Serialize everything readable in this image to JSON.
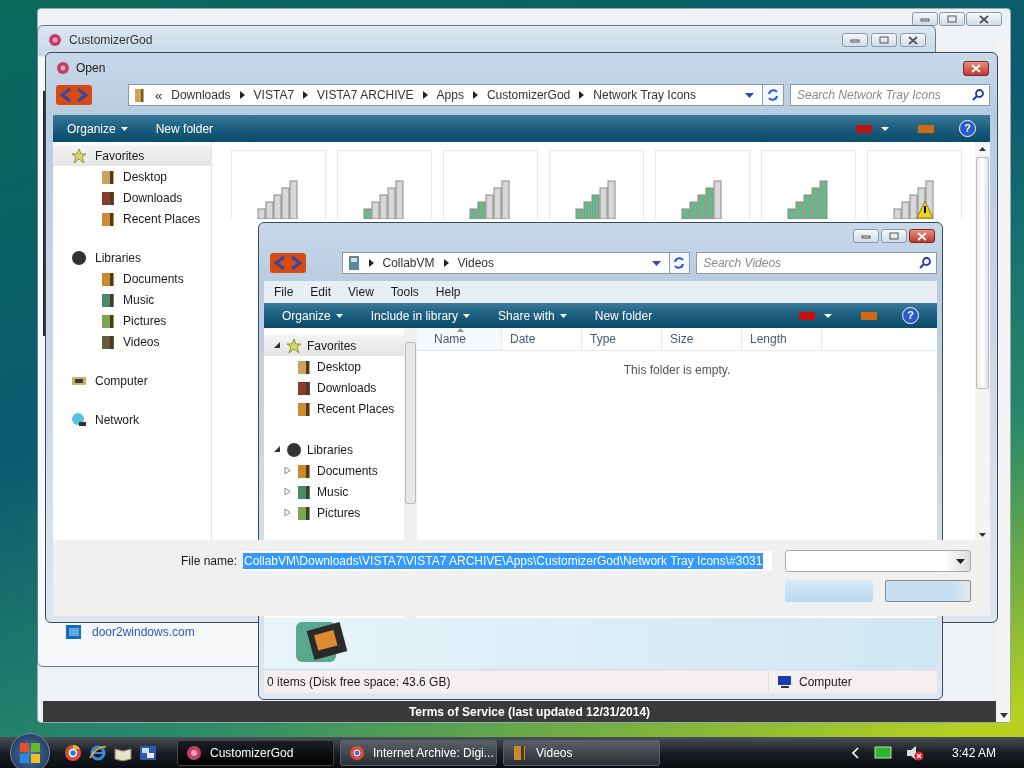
{
  "browser_window": {
    "footer": "Terms of Service (last updated 12/31/2014)"
  },
  "app_window": {
    "title": "CustomizerGod",
    "link": "door2windows.com"
  },
  "open_dialog": {
    "title": "Open",
    "overflow": "«",
    "breadcrumb": [
      "Downloads",
      "VISTA7",
      "VISTA7 ARCHIVE",
      "Apps",
      "CustomizerGod",
      "Network Tray Icons"
    ],
    "search": {
      "placeholder": "Search Network Tray Icons"
    },
    "toolbar": [
      {
        "label": "Organize",
        "menu": true
      },
      {
        "label": "New folder",
        "menu": false
      }
    ],
    "help": "?",
    "sidebar": [
      {
        "label": "Favorites",
        "selected": true,
        "children": [
          {
            "label": "Desktop",
            "selected": false
          },
          {
            "label": "Downloads",
            "selected": false
          },
          {
            "label": "Recent Places",
            "selected": false
          }
        ]
      },
      {
        "label": "Libraries",
        "selected": false,
        "children": [
          {
            "label": "Documents",
            "selected": false
          },
          {
            "label": "Music",
            "selected": false
          },
          {
            "label": "Pictures",
            "selected": false
          },
          {
            "label": "Videos",
            "selected": false
          }
        ]
      },
      {
        "label": "Computer",
        "selected": false
      },
      {
        "label": "Network",
        "selected": false
      }
    ],
    "thumbnails": [
      {
        "kind": "none"
      },
      {
        "kind": "one"
      },
      {
        "kind": "two"
      },
      {
        "kind": "three"
      },
      {
        "kind": "four"
      },
      {
        "kind": "five"
      },
      {
        "kind": "alert"
      }
    ],
    "file_name": {
      "label": "File name:",
      "value": "CollabVM\\Downloads\\VISTA7\\VISTA7 ARCHIVE\\Apps\\CustomizerGod\\Network Tray Icons\\#3031",
      "selected": true
    }
  },
  "explorer": {
    "breadcrumb": [
      "CollabVM",
      "Videos"
    ],
    "search": {
      "placeholder": "Search Videos"
    },
    "menu": [
      "File",
      "Edit",
      "View",
      "Tools",
      "Help"
    ],
    "toolbar": [
      {
        "label": "Organize",
        "menu": true
      },
      {
        "label": "Include in library",
        "menu": true
      },
      {
        "label": "Share with",
        "menu": true
      },
      {
        "label": "New folder",
        "menu": false
      }
    ],
    "help": "?",
    "tree": [
      {
        "label": "Favorites",
        "expanded": true,
        "selected": true,
        "children": [
          {
            "label": "Desktop",
            "selected": false
          },
          {
            "label": "Downloads",
            "selected": false
          },
          {
            "label": "Recent Places",
            "selected": false
          }
        ]
      },
      {
        "label": "Libraries",
        "expanded": true,
        "selected": false,
        "children": [
          {
            "label": "Documents",
            "expanded": false,
            "selected": false
          },
          {
            "label": "Music",
            "expanded": false,
            "selected": false
          },
          {
            "label": "Pictures",
            "expanded": false,
            "selected": false
          }
        ]
      }
    ],
    "columns": [
      {
        "label": "Name",
        "sorted": true
      },
      {
        "label": "Date",
        "sorted": false
      },
      {
        "label": "Type",
        "sorted": false
      },
      {
        "label": "Size",
        "sorted": false
      },
      {
        "label": "Length",
        "sorted": false
      }
    ],
    "empty_message": "This folder is empty.",
    "status_bar": {
      "items": "0 items (Disk free space: 43.6 GB)",
      "location": "Computer"
    }
  },
  "taskbar": {
    "tasks": [
      {
        "label": "CustomizerGod",
        "selected": true
      },
      {
        "label": "Internet Archive: Digi...",
        "selected": false
      },
      {
        "label": "Videos",
        "selected": false
      }
    ],
    "clock": "3:42 AM"
  }
}
